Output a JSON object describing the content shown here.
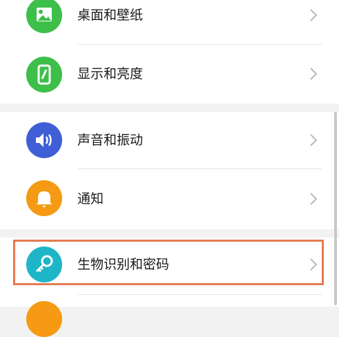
{
  "settings": {
    "items": [
      {
        "label": "桌面和壁纸",
        "icon": "image-icon",
        "color": "#3dbf4a"
      },
      {
        "label": "显示和亮度",
        "icon": "phone-brightness-icon",
        "color": "#3dbf4a"
      },
      {
        "label": "声音和振动",
        "icon": "speaker-icon",
        "color": "#3f5fd6"
      },
      {
        "label": "通知",
        "icon": "bell-icon",
        "color": "#f59a12"
      },
      {
        "label": "生物识别和密码",
        "icon": "key-icon",
        "color": "#1fb5c8"
      }
    ]
  },
  "colors": {
    "highlight": "#e57a4f",
    "background": "#f2f2f2"
  }
}
